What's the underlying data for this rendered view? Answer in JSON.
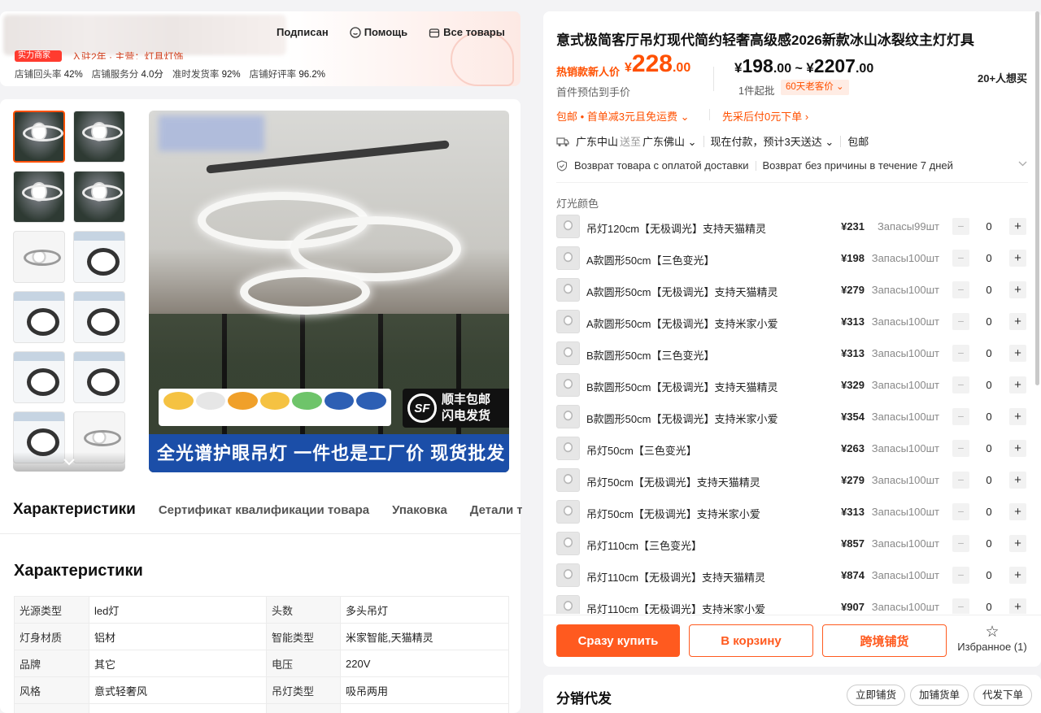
{
  "shop": {
    "badge": "实力商家",
    "sub": "入驻2年 · 主营：灯具灯饰",
    "links": [
      {
        "label": "Подписан",
        "icon": "heart-icon"
      },
      {
        "label": "Помощь",
        "icon": "help-icon"
      },
      {
        "label": "Все товары",
        "icon": "store-icon"
      }
    ],
    "stats": [
      {
        "label": "店铺回头率",
        "value": "42%"
      },
      {
        "label": "店铺服务分",
        "value": "4.0分"
      },
      {
        "label": "准时发货率",
        "value": "92%"
      },
      {
        "label": "店铺好评率",
        "value": "96.2%"
      }
    ]
  },
  "gallery": {
    "sf_text_1": "顺丰包邮",
    "sf_text_2": "闪电发货",
    "sf_logo": "SF",
    "banner": "全光谱护眼吊灯 一件也是工厂价 现货批发",
    "more_icon": "chevron-down-icon"
  },
  "tabs": [
    "Характеристики",
    "Сертификат квалификации товара",
    "Упаковка",
    "Детали т"
  ],
  "specs": {
    "title": "Характеристики",
    "rows": [
      [
        "光源类型",
        "led灯",
        "头数",
        "多头吊灯"
      ],
      [
        "灯身材质",
        "铝材",
        "智能类型",
        "米家智能,天猫精灵"
      ],
      [
        "品牌",
        "其它",
        "电压",
        "220V"
      ],
      [
        "风格",
        "意式轻奢风",
        "吊灯类型",
        "吸吊两用"
      ],
      [
        "",
        "",
        "",
        ""
      ]
    ]
  },
  "product": {
    "title": "意式极简客厅吊灯现代简约轻奢高级感2026新款冰山冰裂纹主灯灯具",
    "hot_label": "热销款新人价",
    "hot_price": {
      "currency": "¥",
      "int": "228",
      "dec": ".00"
    },
    "est_label": "首件预估到手价",
    "range": {
      "currency": "¥",
      "low_int": "198",
      "low_dec": ".00",
      "sep": " ~ ",
      "high_int": "2207",
      "high_dec": ".00"
    },
    "moq": "1件起批",
    "moq_tag": "60天老客价 ⌄",
    "wants": "20+人想买",
    "promo_1": "包邮 • 首单减3元且免运费 ⌄",
    "promo_2": "先采后付0元下单 ›",
    "ship": {
      "from": "广东中山",
      "to_label": "送至",
      "to": "广东佛山 ⌄",
      "pay": "现在付款，预计3天送达 ⌄",
      "free": "包邮"
    },
    "returns": [
      "Возврат товара с оплатой доставки",
      "Возврат без причины в течение 7 дней"
    ],
    "option_label": "灯光颜色"
  },
  "options": [
    {
      "name": "吊灯120cm【无极调光】支持天猫精灵",
      "price": "¥231",
      "stock": "Запасы99шт",
      "qty": "0"
    },
    {
      "name": "A款圆形50cm【三色变光】",
      "price": "¥198",
      "stock": "Запасы100шт",
      "qty": "0"
    },
    {
      "name": "A款圆形50cm【无极调光】支持天猫精灵",
      "price": "¥279",
      "stock": "Запасы100шт",
      "qty": "0"
    },
    {
      "name": "A款圆形50cm【无极调光】支持米家小爱",
      "price": "¥313",
      "stock": "Запасы100шт",
      "qty": "0"
    },
    {
      "name": "B款圆形50cm【三色变光】",
      "price": "¥313",
      "stock": "Запасы100шт",
      "qty": "0"
    },
    {
      "name": "B款圆形50cm【无极调光】支持天猫精灵",
      "price": "¥329",
      "stock": "Запасы100шт",
      "qty": "0"
    },
    {
      "name": "B款圆形50cm【无极调光】支持米家小爱",
      "price": "¥354",
      "stock": "Запасы100шт",
      "qty": "0"
    },
    {
      "name": "吊灯50cm【三色变光】",
      "price": "¥263",
      "stock": "Запасы100шт",
      "qty": "0"
    },
    {
      "name": "吊灯50cm【无极调光】支持天猫精灵",
      "price": "¥279",
      "stock": "Запасы100шт",
      "qty": "0"
    },
    {
      "name": "吊灯50cm【无极调光】支持米家小爱",
      "price": "¥313",
      "stock": "Запасы100шт",
      "qty": "0"
    },
    {
      "name": "吊灯110cm【三色变光】",
      "price": "¥857",
      "stock": "Запасы100шт",
      "qty": "0"
    },
    {
      "name": "吊灯110cm【无极调光】支持天猫精灵",
      "price": "¥874",
      "stock": "Запасы100шт",
      "qty": "0"
    },
    {
      "name": "吊灯110cm【无极调光】支持米家小爱",
      "price": "¥907",
      "stock": "Запасы100шт",
      "qty": "0"
    }
  ],
  "actions": {
    "buy": "Сразу купить",
    "cart": "В корзину",
    "cross": "跨境铺货",
    "fav": "Избранное (1)"
  },
  "distribution": {
    "title": "分销代发",
    "buttons": [
      "立即铺货",
      "加铺货单",
      "代发下单"
    ]
  },
  "colors": {
    "accent": "#ff5000",
    "banner": "#1b4ea8"
  }
}
